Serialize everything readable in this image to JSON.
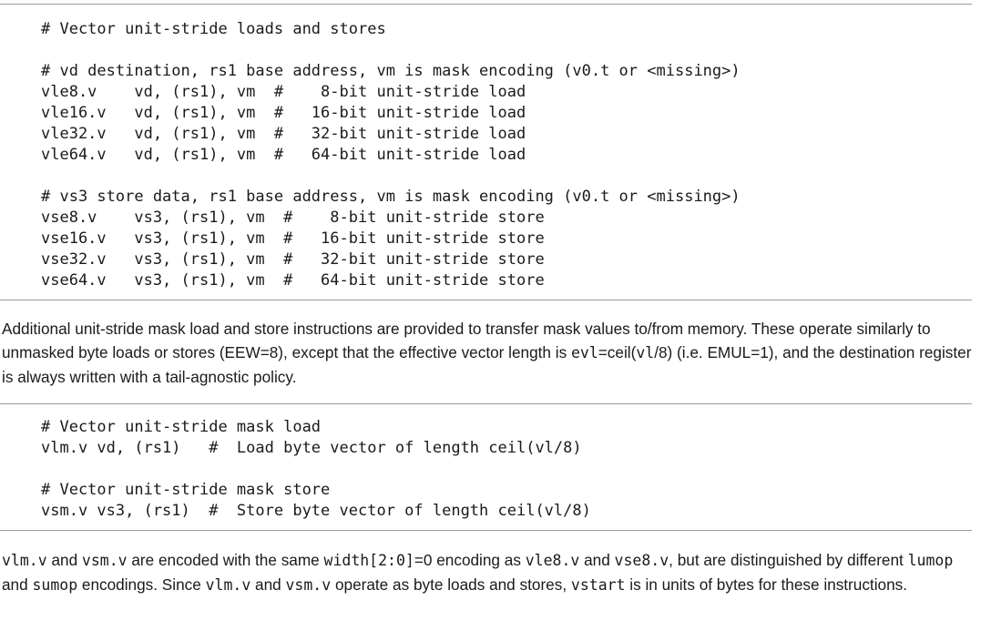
{
  "listing_unit_stride": [
    "# Vector unit-stride loads and stores",
    "",
    "# vd destination, rs1 base address, vm is mask encoding (v0.t or <missing>)",
    "vle8.v    vd, (rs1), vm  #    8-bit unit-stride load",
    "vle16.v   vd, (rs1), vm  #   16-bit unit-stride load",
    "vle32.v   vd, (rs1), vm  #   32-bit unit-stride load",
    "vle64.v   vd, (rs1), vm  #   64-bit unit-stride load",
    "",
    "# vs3 store data, rs1 base address, vm is mask encoding (v0.t or <missing>)",
    "vse8.v    vs3, (rs1), vm  #    8-bit unit-stride store",
    "vse16.v   vs3, (rs1), vm  #   16-bit unit-stride store",
    "vse32.v   vs3, (rs1), vm  #   32-bit unit-stride store",
    "vse64.v   vs3, (rs1), vm  #   64-bit unit-stride store"
  ],
  "paragraph_mask": {
    "text_1": "Additional unit-stride mask load and store instructions are provided to transfer mask values to/from memory. These operate similarly to unmasked byte loads or stores (EEW=8), except that the effective vector length is ",
    "code_1": "evl",
    "text_2": "=ceil(",
    "code_2": "vl",
    "text_3": "/8) (i.e. EMUL=1), and the destination register is always written with a tail-agnostic policy."
  },
  "listing_mask": [
    "# Vector unit-stride mask load",
    "vlm.v vd, (rs1)   #  Load byte vector of length ceil(vl/8)",
    "",
    "# Vector unit-stride mask store",
    "vsm.v vs3, (rs1)  #  Store byte vector of length ceil(vl/8)"
  ],
  "paragraph_encoding": {
    "code_1": "vlm.v",
    "text_1": " and ",
    "code_2": "vsm.v",
    "text_2": " are encoded with the same ",
    "code_3": "width[2:0]",
    "text_3": "=0 encoding as ",
    "code_4": "vle8.v",
    "text_4": " and ",
    "code_5": "vse8.v",
    "text_5": ", but are distinguished by different ",
    "code_6": "lumop",
    "text_6": " and ",
    "code_7": "sumop",
    "text_7": " encodings. Since ",
    "code_8": "vlm.v",
    "text_8": " and ",
    "code_9": "vsm.v",
    "text_9": " operate as byte loads and stores, ",
    "code_10": "vstart",
    "text_10": " is in units of bytes for these instructions."
  }
}
